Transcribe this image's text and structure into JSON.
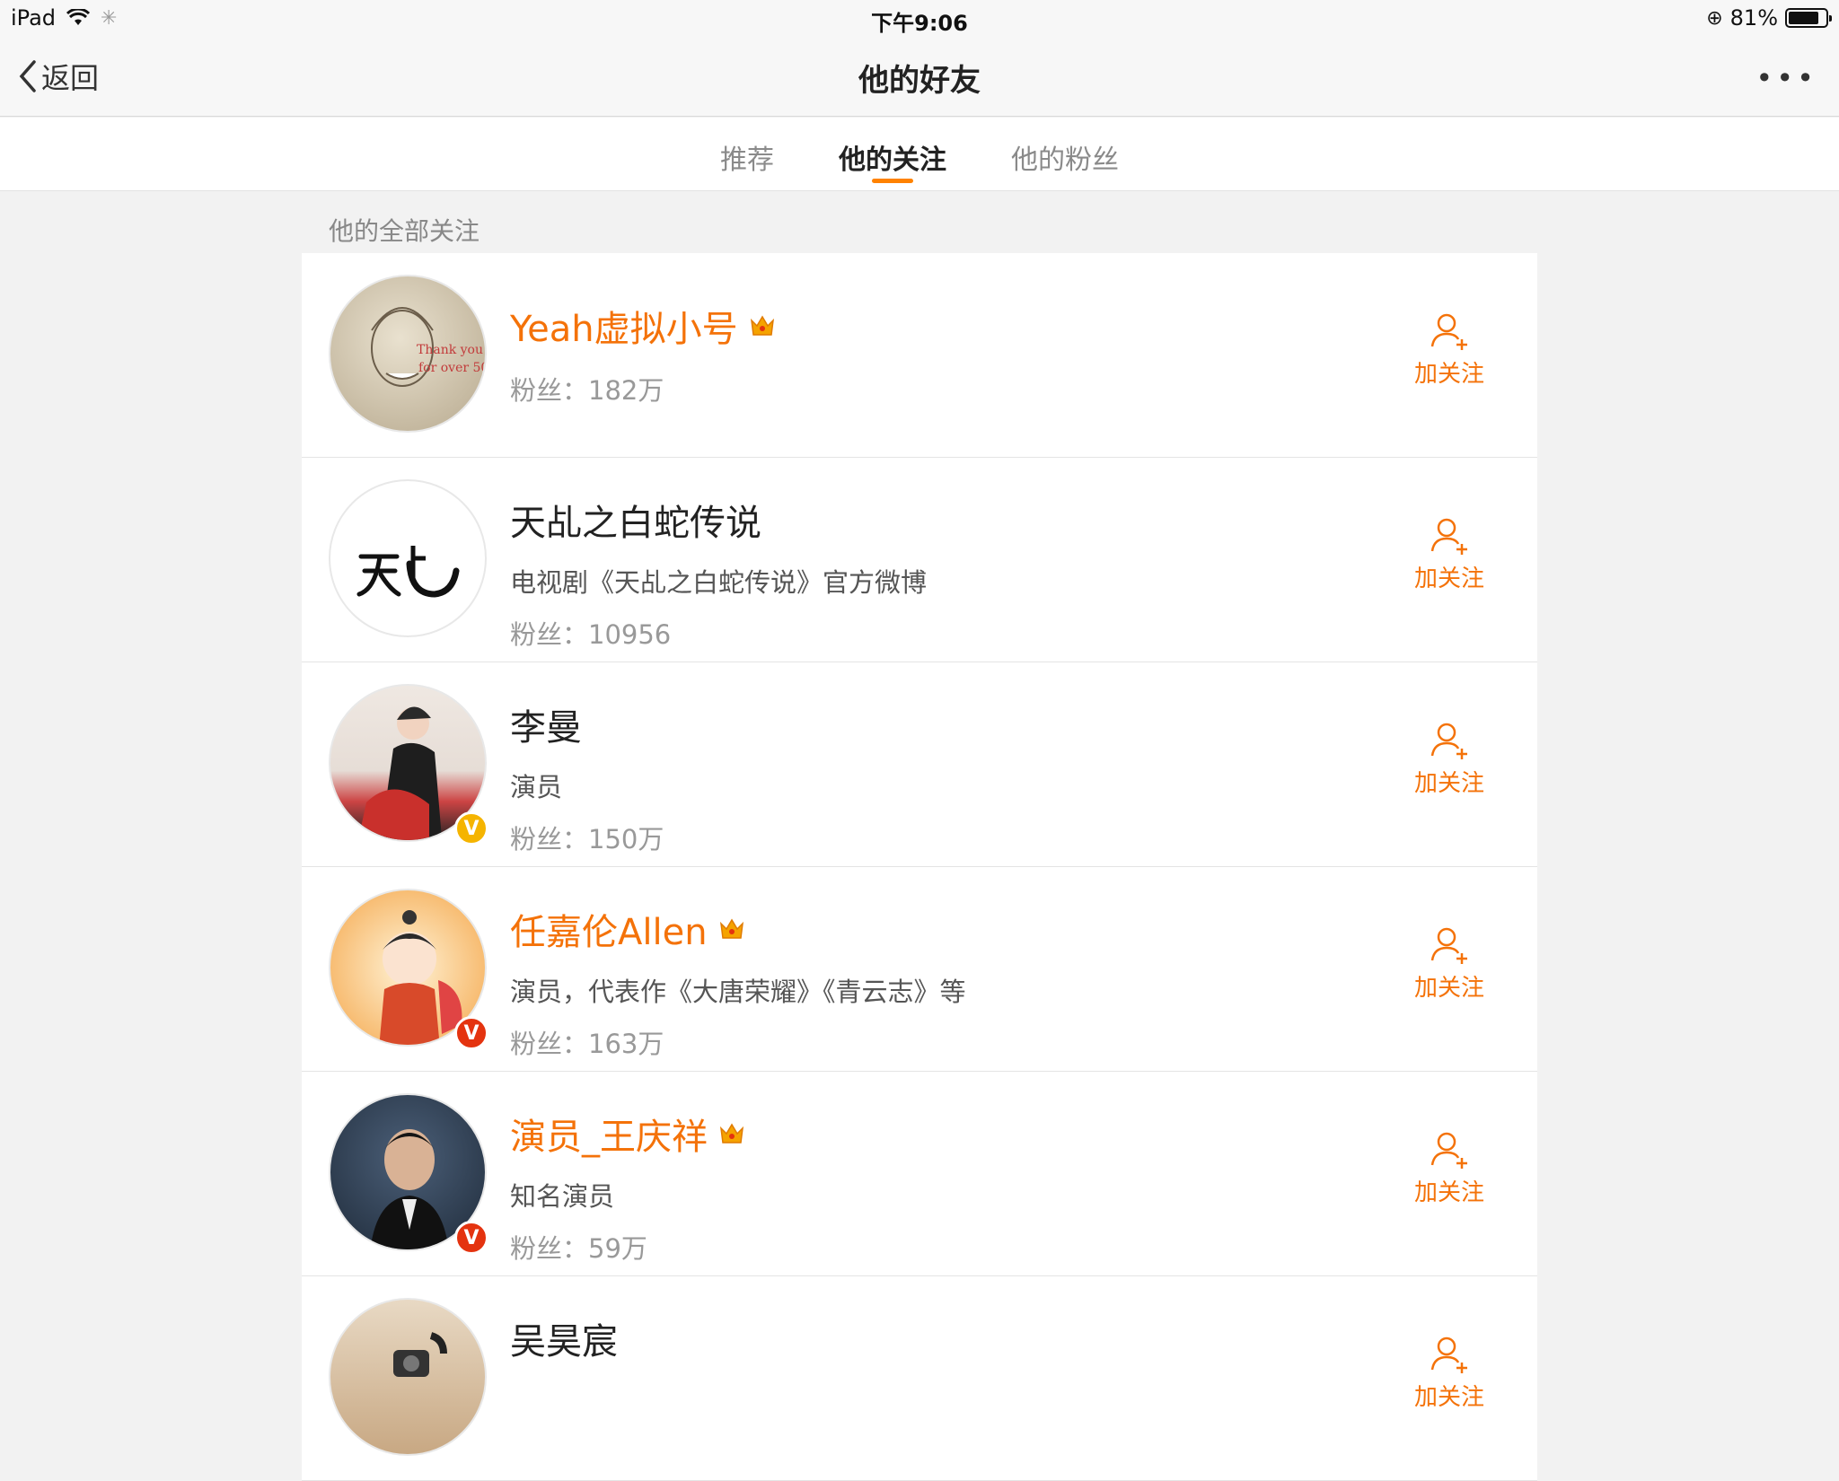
{
  "status_bar": {
    "device": "iPad",
    "time": "下午9:06",
    "battery": "81%"
  },
  "nav": {
    "back_label": "返回",
    "title": "他的好友",
    "more_label": "•••"
  },
  "tabs": [
    {
      "label": "推荐"
    },
    {
      "label": "他的关注"
    },
    {
      "label": "他的粉丝"
    }
  ],
  "section_title": "他的全部关注",
  "follow_label": "加关注",
  "users": [
    {
      "name": "Yeah虚拟小号",
      "desc": "",
      "fans": "粉丝：182万"
    },
    {
      "name": "天乩之白蛇传说",
      "desc": "电视剧《天乩之白蛇传说》官方微博",
      "fans": "粉丝：10956"
    },
    {
      "name": "李曼",
      "desc": "演员",
      "fans": "粉丝：150万"
    },
    {
      "name": "任嘉伦Allen",
      "desc": "演员，代表作《大唐荣耀》《青云志》等",
      "fans": "粉丝：163万"
    },
    {
      "name": "演员_王庆祥",
      "desc": "知名演员",
      "fans": "粉丝：59万"
    },
    {
      "name": "吴昊宸",
      "desc": "",
      "fans": ""
    }
  ],
  "colors": {
    "accent": "#f47209",
    "tab_underline": "#ff8200"
  }
}
